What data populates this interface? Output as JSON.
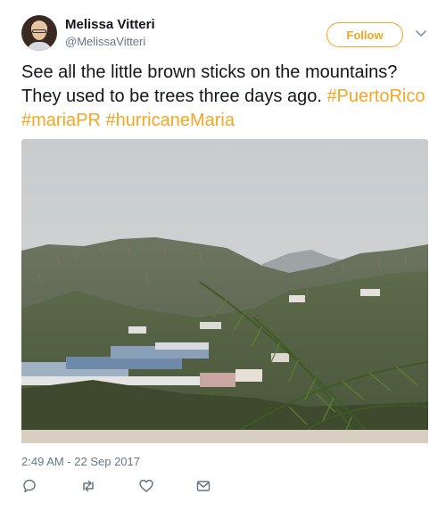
{
  "author": {
    "name": "Melissa Vitteri",
    "handle": "@MelissaVitteri",
    "avatar_icon": "profile-photo"
  },
  "follow_button": {
    "label": "Follow",
    "color": "#f5a623"
  },
  "menu_icon": "chevron-down-icon",
  "tweet": {
    "text_before": "See all the little brown sticks on the mountains? They used to be trees three days ago.",
    "hashtags": [
      "#PuertoRico",
      "#mariaPR",
      "#hurricaneMaria"
    ],
    "hashtag_color": "#f5a623"
  },
  "media": {
    "kind": "photo",
    "description_icon": "landscape-photo"
  },
  "timestamp": "2:49 AM - 22 Sep 2017",
  "actions": [
    {
      "name": "reply",
      "icon": "reply-icon"
    },
    {
      "name": "retweet",
      "icon": "retweet-icon"
    },
    {
      "name": "like",
      "icon": "heart-icon"
    },
    {
      "name": "direct-message",
      "icon": "envelope-icon"
    }
  ]
}
